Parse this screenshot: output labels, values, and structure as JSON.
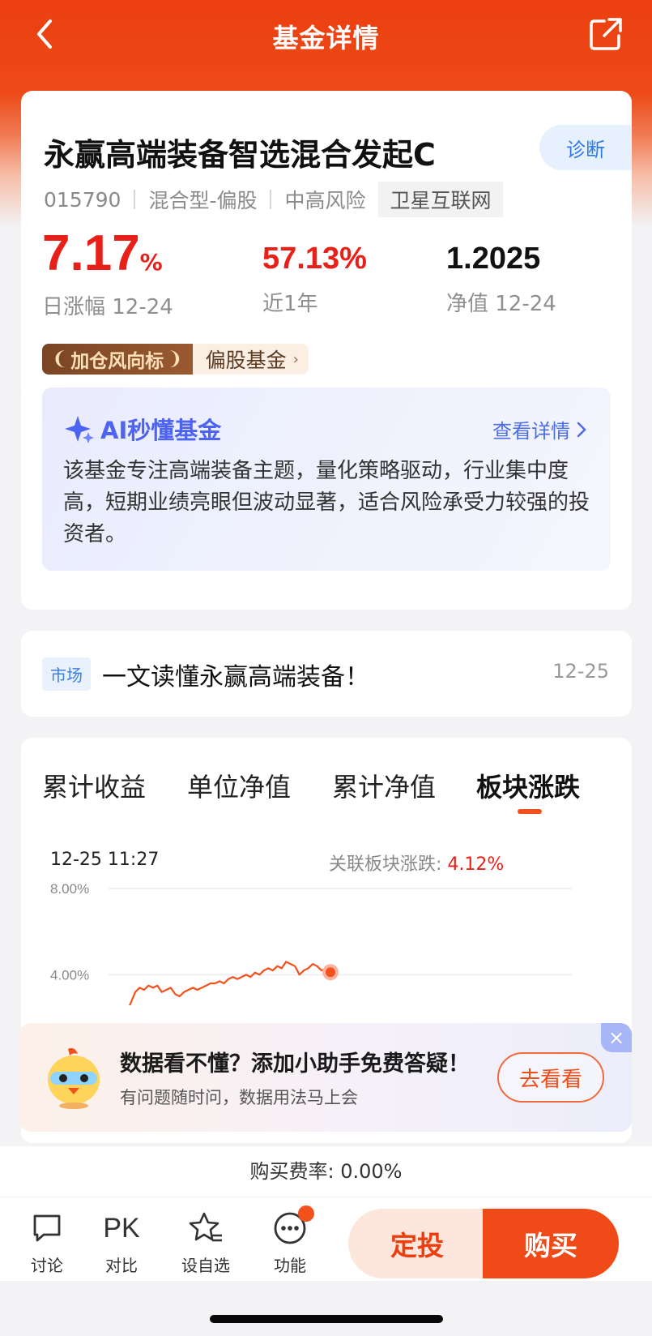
{
  "header": {
    "title": "基金详情",
    "back_icon": "chevron-left-icon",
    "share_icon": "share-icon"
  },
  "fund": {
    "name": "永赢高端装备智选混合发起C",
    "diagnose_label": "诊断",
    "code": "015790",
    "type": "混合型-偏股",
    "risk": "中高风险",
    "theme_tag": "卫星互联网",
    "daily_change_value": "7.17",
    "daily_change_unit": "%",
    "daily_change_label": "日涨幅 12-24",
    "year_return": "57.13%",
    "year_return_label": "近1年",
    "nav": "1.2025",
    "nav_label": "净值 12-24",
    "badge_dark": "加仓风向标",
    "badge_light": "偏股基金",
    "badge_arrow": "›"
  },
  "ai": {
    "title": "AI秒懂基金",
    "link": "查看详情",
    "text": "该基金专注高端装备主题，量化策略驱动，行业集中度高，短期业绩亮眼但波动显著，适合风险承受力较强的投资者。"
  },
  "news": {
    "tag": "市场",
    "title": "一文读懂永赢高端装备！",
    "date": "12-25"
  },
  "chart": {
    "tabs": [
      "累计收益",
      "单位净值",
      "累计净值",
      "板块涨跌"
    ],
    "active_tab": 3,
    "timestamp": "12-25 11:27",
    "related_label": "关联板块涨跌:",
    "related_value": "4.12%"
  },
  "chart_data": {
    "type": "line",
    "y_ticks": [
      "8.00%",
      "4.00%"
    ],
    "ylim": [
      0,
      8
    ],
    "series": [
      {
        "values": [
          2.2,
          2.7,
          3.2,
          3.4,
          3.3,
          3.5,
          3.4,
          3.5,
          3.2,
          3.3,
          3.4,
          3.1,
          3.0,
          3.2,
          3.3,
          3.4,
          3.3,
          3.4,
          3.5,
          3.6,
          3.6,
          3.7,
          3.6,
          3.8,
          3.9,
          3.8,
          3.9,
          4.0,
          3.9,
          4.1,
          4.0,
          4.2,
          4.3,
          4.2,
          4.4,
          4.3,
          4.6,
          4.5,
          4.4,
          4.0,
          4.2,
          4.3,
          4.5,
          4.4,
          4.2,
          4.3,
          4.12
        ]
      }
    ],
    "grid": true,
    "color": "#f2511b"
  },
  "promo": {
    "title": "数据看不懂？添加小助手免费答疑！",
    "subtitle": "有问题随时问，数据用法马上会",
    "button": "去看看",
    "close": "×"
  },
  "bottom": {
    "fee": "购买费率: 0.00%",
    "items": [
      {
        "label": "讨论",
        "icon": "comment-icon"
      },
      {
        "label": "对比",
        "icon": "PK"
      },
      {
        "label": "设自选",
        "icon": "star-list-icon"
      },
      {
        "label": "功能",
        "icon": "more-dots-icon"
      }
    ],
    "dingtou": "定投",
    "buy": "购买"
  }
}
